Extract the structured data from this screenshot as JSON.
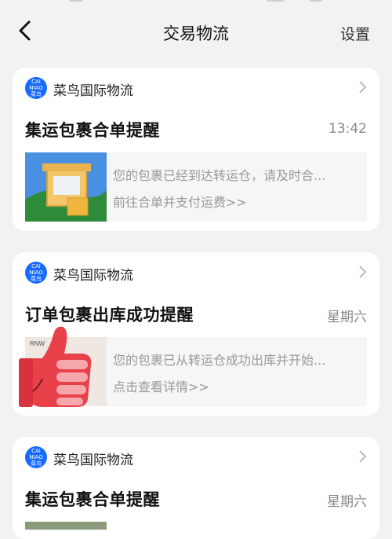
{
  "header": {
    "title": "交易物流",
    "settings_label": "设置"
  },
  "messages": [
    {
      "source_name": "菜鸟国际物流",
      "logo_text": [
        "CAI",
        "NIAO",
        "菜鸟"
      ],
      "title": "集运包裹合单提醒",
      "time": "13:42",
      "preview_text": "您的包裹已经到达转运仓，请及时合...",
      "preview_link": "前往合单并支付运费>>"
    },
    {
      "source_name": "菜鸟国际物流",
      "logo_text": [
        "CAI",
        "NIAO",
        "菜鸟"
      ],
      "title": "订单包裹出库成功提醒",
      "time": "星期六",
      "preview_text": "您的包裹已从转运仓成功出库并开始...",
      "preview_link": "点击查看详情>>",
      "thumb_text": "RNW"
    },
    {
      "source_name": "菜鸟国际物流",
      "logo_text": [
        "CAI",
        "NIAO",
        "菜鸟"
      ],
      "title": "集运包裹合单提醒",
      "time": "星期六"
    }
  ],
  "colors": {
    "brand_blue": "#1769ff",
    "overlay_red": "#e8414a"
  }
}
